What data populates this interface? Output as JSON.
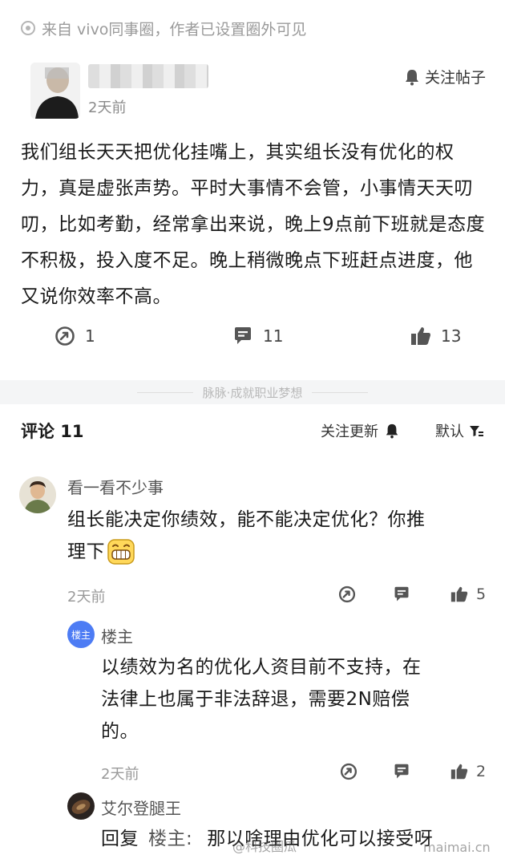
{
  "source": {
    "text": "来自 vivo同事圈，作者已设置圈外可见"
  },
  "post": {
    "time": "2天前",
    "follow_label": "关注帖子",
    "body": "我们组长天天把优化挂嘴上，其实组长没有优化的权力，真是虚张声势。平时大事情不会管，小事情天天叨叨，比如考勤，经常拿出来说，晚上9点前下班就是态度不积极，投入度不足。晚上稍微晚点下班赶点进度，他又说你效率不高。",
    "stats": {
      "share": "1",
      "comments": "11",
      "likes": "13"
    }
  },
  "divider": {
    "slogan": "脉脉·成就职业梦想"
  },
  "comments_header": {
    "title": "评论 11",
    "follow_updates": "关注更新",
    "sort": "默认"
  },
  "comments": [
    {
      "name": "看一看不少事",
      "text_line1": "组长能决定你绩效，能不能决定优化？你推",
      "text_line2": "理下",
      "time": "2天前",
      "likes": "5"
    },
    {
      "badge": "楼主",
      "name": "楼主",
      "text_line1": "以绩效为名的优化人资目前不支持，在",
      "text_line2": "法律上也属于非法辞退，需要2N赔偿",
      "text_line3": "的。",
      "time": "2天前",
      "likes": "2"
    },
    {
      "name": "艾尔登腿王",
      "reply_prefix": "回复",
      "reply_to": "楼主:",
      "text_line1": "那以啥理由优化可以接受呀"
    }
  ],
  "watermarks": {
    "weibo": "@科技圈瓜",
    "site": "maimai.cn"
  },
  "colors": {
    "accent_blue": "#4d7cf4",
    "band": "#f4f5f6",
    "muted": "#999999"
  }
}
